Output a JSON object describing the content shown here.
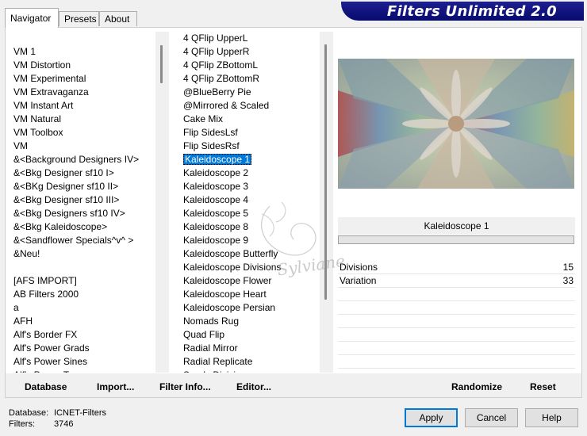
{
  "banner": {
    "title": "Filters Unlimited 2.0"
  },
  "tabs": [
    {
      "label": "Navigator",
      "active": true
    },
    {
      "label": "Presets",
      "active": false
    },
    {
      "label": "About",
      "active": false
    }
  ],
  "categories": [
    "VM 1",
    "VM Distortion",
    "VM Experimental",
    "VM Extravaganza",
    "VM Instant Art",
    "VM Natural",
    "VM Toolbox",
    "VM",
    "&<Background Designers IV>",
    "&<Bkg Designer sf10 I>",
    "&<BKg Designer sf10 II>",
    "&<Bkg Designer sf10 III>",
    "&<Bkg Designers sf10 IV>",
    "&<Bkg Kaleidoscope>",
    "&<Sandflower Specials^v^ >",
    "&Neu!",
    "",
    "[AFS IMPORT]",
    "AB Filters 2000",
    "a",
    "AFH",
    "Alf's Border FX",
    "Alf's Power Grads",
    "Alf's Power Sines",
    "Alf's Power Toys"
  ],
  "filters": [
    "4 QFlip UpperL",
    "4 QFlip UpperR",
    "4 QFlip ZBottomL",
    "4 QFlip ZBottomR",
    "@BlueBerry Pie",
    "@Mirrored & Scaled",
    "Cake Mix",
    "Flip SidesLsf",
    "Flip SidesRsf",
    "Kaleidoscope 1",
    "Kaleidoscope 2",
    "Kaleidoscope 3",
    "Kaleidoscope 4",
    "Kaleidoscope 5",
    "Kaleidoscope 8",
    "Kaleidoscope 9",
    "Kaleidoscope Butterfly",
    "Kaleidoscope Divisions",
    "Kaleidoscope Flower",
    "Kaleidoscope Heart",
    "Kaleidoscope Persian",
    "Nomads Rug",
    "Quad Flip",
    "Radial Mirror",
    "Radial Replicate",
    "Seeds Divisions"
  ],
  "selected_filter": "Kaleidoscope 1",
  "selected_category": "&<Bkg Kaleidoscope>",
  "filter_title": "Kaleidoscope 1",
  "params": [
    {
      "label": "Divisions",
      "value": "15"
    },
    {
      "label": "Variation",
      "value": "33"
    }
  ],
  "left_buttons": {
    "database": "Database",
    "import": "Import...",
    "filter_info": "Filter Info...",
    "editor": "Editor..."
  },
  "right_buttons": {
    "randomize": "Randomize",
    "reset": "Reset"
  },
  "footer": {
    "database_label": "Database:",
    "database_value": "ICNET-Filters",
    "filters_label": "Filters:",
    "filters_value": "3746"
  },
  "dialog_buttons": {
    "apply": "Apply",
    "cancel": "Cancel",
    "help": "Help"
  },
  "watermark": "Sylviane",
  "colors": {
    "banner": "#0a0d78",
    "selection": "#0078d7",
    "default_button_border": "#0078d7"
  }
}
